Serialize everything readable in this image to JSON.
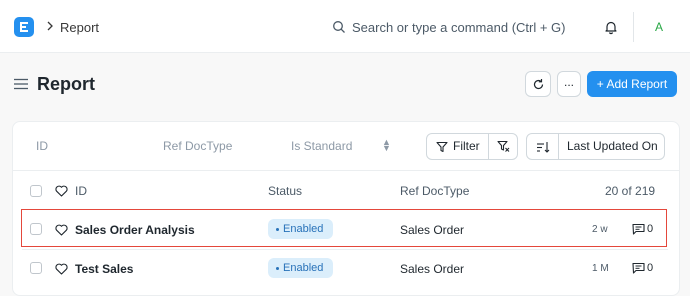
{
  "navbar": {
    "logo_icon": "frappe-logo-icon",
    "breadcrumb": "Report",
    "search_placeholder": "Search or type a command (Ctrl + G)",
    "avatar_initial": "A",
    "colors": {
      "logo": "#2490ef",
      "avatar": "#28a745"
    }
  },
  "page": {
    "title": "Report",
    "more_label": "...",
    "add_label": "+ Add Report",
    "accent_color": "#2490ef"
  },
  "filters": {
    "id_placeholder": "ID",
    "ref_doctype_placeholder": "Ref DocType",
    "is_standard_placeholder": "Is Standard",
    "filter_label": "Filter",
    "sort_label": "Last Updated On"
  },
  "list": {
    "columns": {
      "id": "ID",
      "status": "Status",
      "ref_doctype": "Ref DocType"
    },
    "count": "20 of 219",
    "rows": [
      {
        "title": "Sales Order Analysis",
        "status": "Enabled",
        "ref_doctype": "Sales Order",
        "modified": "2 w",
        "comments": "0",
        "highlighted": true
      },
      {
        "title": "Test Sales",
        "status": "Enabled",
        "ref_doctype": "Sales Order",
        "modified": "1 M",
        "comments": "0",
        "highlighted": false
      }
    ],
    "highlight_color": "#e4473b",
    "status_color": "#2872b9"
  }
}
